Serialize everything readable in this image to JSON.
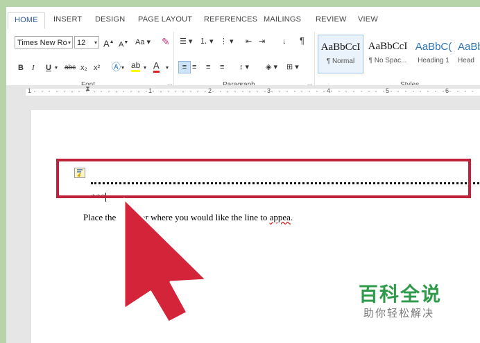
{
  "ribbon": {
    "tabs": [
      {
        "label": "HOME"
      },
      {
        "label": "INSERT"
      },
      {
        "label": "DESIGN"
      },
      {
        "label": "PAGE LAYOUT"
      },
      {
        "label": "REFERENCES"
      },
      {
        "label": "MAILINGS"
      },
      {
        "label": "REVIEW"
      },
      {
        "label": "VIEW"
      }
    ],
    "active_tab": "HOME",
    "font": {
      "name": "Times New Ro",
      "size": "12",
      "grow": "A",
      "shrink": "A",
      "change_case": "Aa",
      "bold": "B",
      "italic": "I",
      "underline": "U",
      "strikethrough": "abc",
      "subscript": "x₂",
      "superscript": "x²",
      "group_label": "Font"
    },
    "paragraph": {
      "group_label": "Paragraph",
      "pilcrow": "¶"
    },
    "styles": {
      "group_label": "Styles",
      "items": [
        {
          "sample": "AaBbCcI",
          "name": "¶ Normal"
        },
        {
          "sample": "AaBbCcI",
          "name": "¶ No Spac..."
        },
        {
          "sample": "AaBbC(",
          "name": "Heading 1"
        },
        {
          "sample": "AaBbC",
          "name": "Head"
        }
      ]
    }
  },
  "ruler": {
    "numbers": [
      "1",
      "1",
      "2",
      "3",
      "4",
      "5",
      "6"
    ]
  },
  "document": {
    "line_text": "***",
    "paragraph_before": "Place the",
    "paragraph_hidden": "cursor",
    "paragraph_mid": "or where you would like the line to ",
    "paragraph_misspelled": "appea",
    "paragraph_end": "."
  },
  "watermark": {
    "title": "百科全说",
    "subtitle": "助你轻松解决"
  },
  "colors": {
    "highlight_box": "#c0223b",
    "arrow": "#d4243a",
    "accent": "#2b579a",
    "watermark_green": "#2f9a4a"
  }
}
